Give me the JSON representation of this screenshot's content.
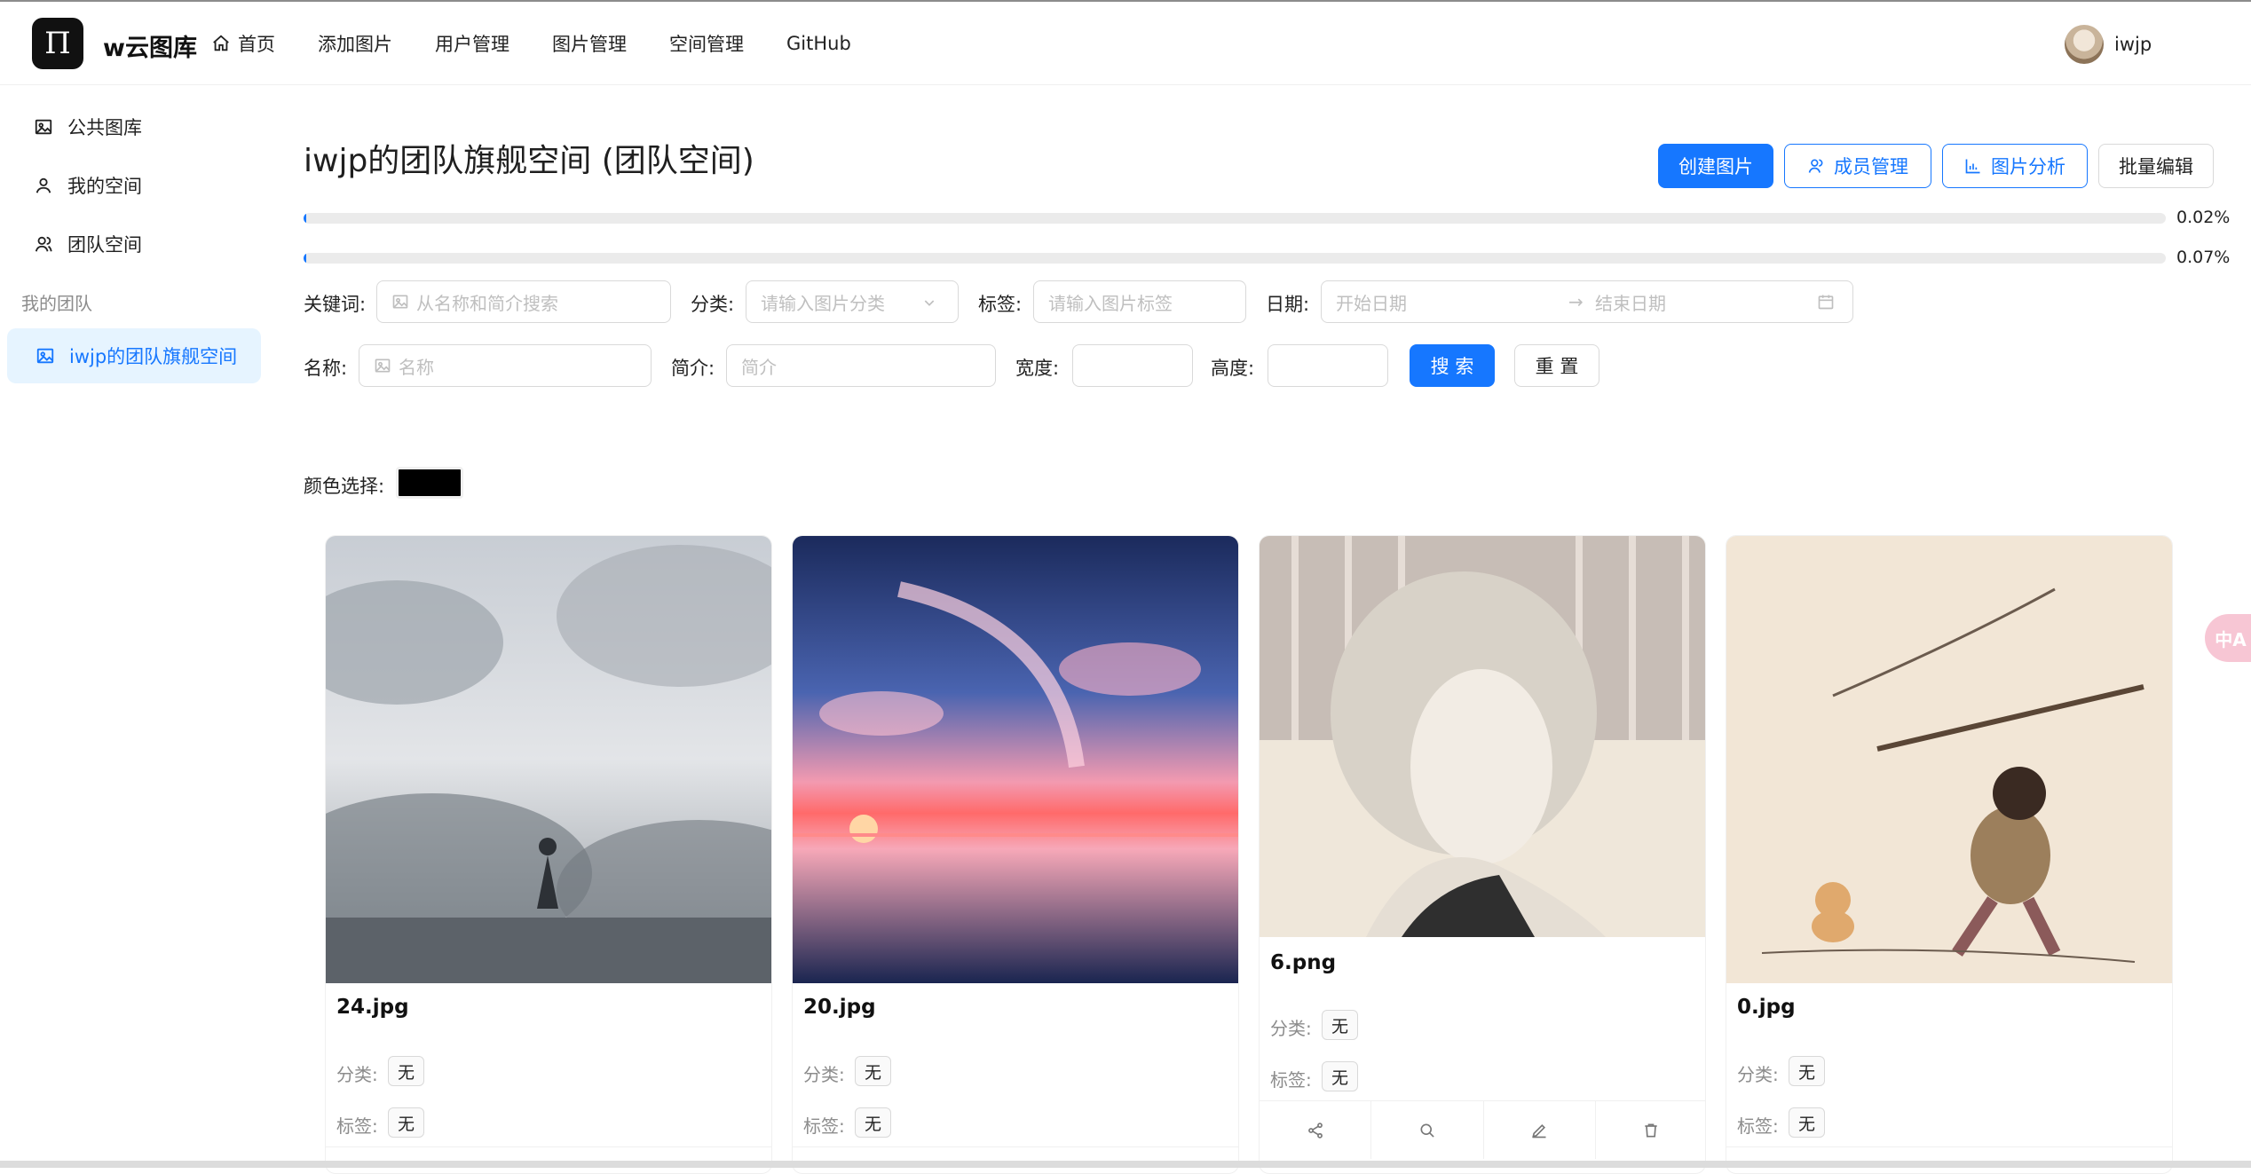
{
  "app": {
    "logo_glyph": "Π",
    "name": "w云图库"
  },
  "nav": {
    "home": "首页",
    "add_picture": "添加图片",
    "user_manage": "用户管理",
    "picture_manage": "图片管理",
    "space_manage": "空间管理",
    "github": "GitHub"
  },
  "user": {
    "name": "iwjp"
  },
  "sidebar": {
    "public_gallery": "公共图库",
    "my_space": "我的空间",
    "team_space": "团队空间",
    "my_team_heading": "我的团队",
    "active_team": "iwjp的团队旗舰空间"
  },
  "page": {
    "title": "iwjp的团队旗舰空间 (团队空间)"
  },
  "toolbar": {
    "create_picture": "创建图片",
    "member_manage": "成员管理",
    "picture_analysis": "图片分析",
    "batch_edit": "批量编辑"
  },
  "usage": [
    {
      "percent_label": "0.02%",
      "fraction": 0.0002
    },
    {
      "percent_label": "0.07%",
      "fraction": 0.0007
    }
  ],
  "filters": {
    "keyword_label": "关键词:",
    "keyword_placeholder": "从名称和简介搜索",
    "category_label": "分类:",
    "category_placeholder": "请输入图片分类",
    "tags_label": "标签:",
    "tags_placeholder": "请输入图片标签",
    "date_label": "日期:",
    "start_date_placeholder": "开始日期",
    "end_date_placeholder": "结束日期",
    "name_label": "名称:",
    "name_placeholder": "名称",
    "intro_label": "简介:",
    "intro_placeholder": "简介",
    "width_label": "宽度:",
    "height_label": "高度:",
    "search_button": "搜 索",
    "reset_button": "重 置",
    "color_label": "颜色选择:",
    "color_value": "#000000"
  },
  "cards": [
    {
      "title": "24.jpg",
      "category_label": "分类:",
      "category": "无",
      "tags_label": "标签:",
      "tags": "无"
    },
    {
      "title": "20.jpg",
      "category_label": "分类:",
      "category": "无",
      "tags_label": "标签:",
      "tags": "无"
    },
    {
      "title": "6.png",
      "category_label": "分类:",
      "category": "无",
      "tags_label": "标签:",
      "tags": "无"
    },
    {
      "title": "0.jpg",
      "category_label": "分类:",
      "category": "无",
      "tags_label": "标签:",
      "tags": "无"
    }
  ],
  "translate_fab": {
    "glyph": "中A"
  },
  "colors": {
    "primary": "#1677ff",
    "active_bg": "#e6f4ff"
  }
}
